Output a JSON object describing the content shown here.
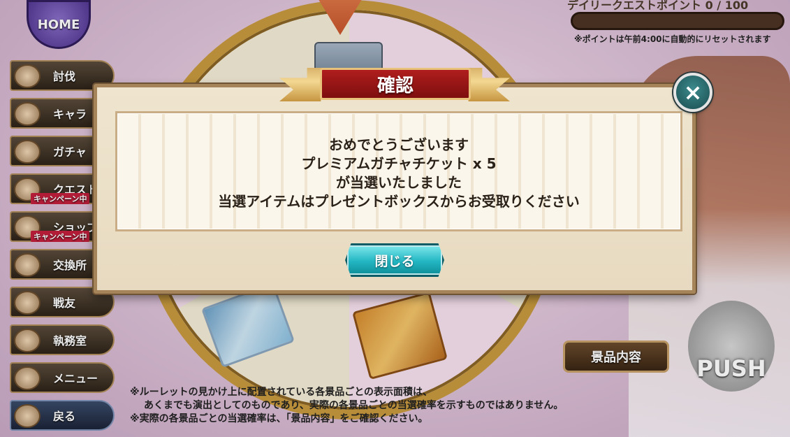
{
  "home": {
    "label": "HOME"
  },
  "side_menu": [
    {
      "label": "討伐",
      "icon": "bird-icon",
      "sub": ""
    },
    {
      "label": "キャラ",
      "icon": "characters-icon",
      "sub": ""
    },
    {
      "label": "ガチャ",
      "icon": "pot-icon",
      "sub": ""
    },
    {
      "label": "クエスト",
      "icon": "map-icon",
      "sub": "キャンペーン中"
    },
    {
      "label": "ショップ",
      "icon": "shop-icon",
      "sub": "キャンペーン中"
    },
    {
      "label": "交換所",
      "icon": "exchange-icon",
      "sub": ""
    },
    {
      "label": "戦友",
      "icon": "swords-icon",
      "sub": ""
    },
    {
      "label": "執務室",
      "icon": "office-icon",
      "sub": ""
    },
    {
      "label": "メニュー",
      "icon": "gear-icon",
      "sub": ""
    },
    {
      "label": "戻る",
      "icon": "back-arrow-icon",
      "sub": ""
    }
  ],
  "daily_quest": {
    "label": "デイリークエストポイント 0 / 100",
    "progress": 0,
    "reset_note": "※ポイントは午前4:00に自動的にリセットされます"
  },
  "prize_list_button": "景品内容",
  "push_button": "PUSH",
  "bottom_notes": {
    "line1": "※ルーレットの見かけ上に配置されている各景品ごとの表示面積は、",
    "line2": "あくまでも演出としてのものであり、実際の各景品ごとの当選確率を示すものではありません。",
    "line3": "※実際の各景品ごとの当選確率は、「景品内容」をご確認ください。"
  },
  "dialog": {
    "title": "確認",
    "close_icon": "×",
    "message_lines": [
      "おめでとうございます",
      "プレミアムガチャチケット x 5",
      "が当選いたしました",
      "当選アイテムはプレゼントボックスからお受取りください"
    ],
    "close_button": "閉じる"
  },
  "colors": {
    "dialog_title_bg": "#b01e1e",
    "close_button_bg": "#22b6c2",
    "close_x_bg": "#1a4c50"
  }
}
